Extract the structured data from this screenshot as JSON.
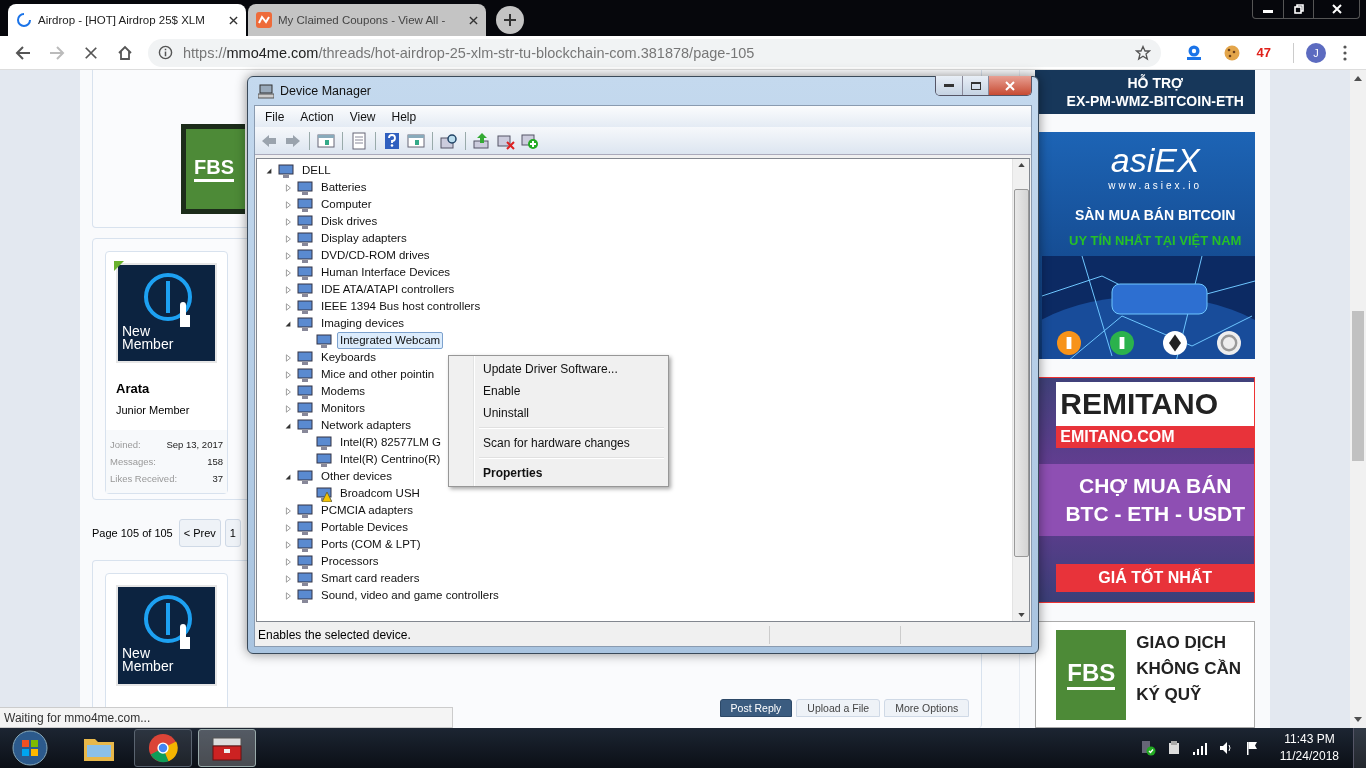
{
  "browser": {
    "tabs": [
      {
        "title": "Airdrop - [HOT] Airdrop 25$ XLM",
        "selected": true,
        "loading": true
      },
      {
        "title": "My Claimed Coupons - View All -",
        "selected": false,
        "loading": false
      }
    ],
    "forward_enabled": false,
    "url_scheme": "https://",
    "url_host": "mmo4me.com",
    "url_path": "/threads/hot-airdrop-25-xlm-str-tu-blockchain-com.381878/page-105",
    "extension_badge": "47",
    "profile_initial": "J",
    "status": "Waiting for mmo4me.com..."
  },
  "forum": {
    "posts": [
      {
        "kind": "banner",
        "banner_text": "FBS"
      },
      {
        "kind": "user",
        "name": "Arata",
        "title": "Junior Member",
        "avatar_label": "New Member",
        "online": true,
        "stats": [
          {
            "label": "Joined:",
            "value": "Sep 13, 2017"
          },
          {
            "label": "Messages:",
            "value": "158"
          },
          {
            "label": "Likes Received:",
            "value": "37"
          }
        ]
      },
      {
        "kind": "user_avatar",
        "avatar_label": "New Member",
        "online": false
      }
    ],
    "pagination": {
      "label": "Page 105 of 105",
      "buttons": [
        "< Prev",
        "1"
      ]
    },
    "actions": [
      {
        "label": "Post Reply",
        "primary": true
      },
      {
        "label": "Upload a File",
        "primary": false
      },
      {
        "label": "More Options",
        "primary": false
      }
    ]
  },
  "ads": [
    {
      "kind": "hotro",
      "lines": [
        "HỖ TRỢ",
        "EX-PM-WMZ-BITCOIN-ETH"
      ]
    },
    {
      "kind": "asiex",
      "logo": "asiEX",
      "site": "www.asiex.io",
      "headline": "SÀN MUA BÁN BITCOIN",
      "tagline": "UY TÍN NHẤT TẠI VIỆT NAM"
    },
    {
      "kind": "remitano",
      "logo": "REMITANO",
      "site": "EMITANO.COM",
      "lines": [
        "CHỢ MUA BÁN",
        "BTC - ETH - USDT"
      ],
      "footer": "GIÁ TỐT NHẤT"
    },
    {
      "kind": "fbs",
      "logo": "FBS",
      "lines": [
        "GIAO DỊCH",
        "KHÔNG CẦN",
        "KÝ QUỸ"
      ]
    }
  ],
  "device_manager": {
    "title": "Device Manager",
    "menu": [
      "File",
      "Action",
      "View",
      "Help"
    ],
    "tree": {
      "label": "DELL",
      "expanded": true,
      "selected": false,
      "children": [
        {
          "label": "Batteries",
          "expanded": false,
          "selected": false
        },
        {
          "label": "Computer",
          "expanded": false,
          "selected": false
        },
        {
          "label": "Disk drives",
          "expanded": false,
          "selected": false
        },
        {
          "label": "Display adapters",
          "expanded": false,
          "selected": false
        },
        {
          "label": "DVD/CD-ROM drives",
          "expanded": false,
          "selected": false
        },
        {
          "label": "Human Interface Devices",
          "expanded": false,
          "selected": false
        },
        {
          "label": "IDE ATA/ATAPI controllers",
          "expanded": false,
          "selected": false
        },
        {
          "label": "IEEE 1394 Bus host controllers",
          "expanded": false,
          "selected": false
        },
        {
          "label": "Imaging devices",
          "expanded": true,
          "selected": false,
          "children": [
            {
              "label": "Integrated Webcam",
              "selected": true,
              "warning": false
            }
          ]
        },
        {
          "label": "Keyboards",
          "expanded": false,
          "selected": false
        },
        {
          "label": "Mice and other pointin",
          "expanded": false,
          "selected": false
        },
        {
          "label": "Modems",
          "expanded": false,
          "selected": false
        },
        {
          "label": "Monitors",
          "expanded": false,
          "selected": false
        },
        {
          "label": "Network adapters",
          "expanded": true,
          "selected": false,
          "children": [
            {
              "label": "Intel(R) 82577LM G",
              "selected": false,
              "warning": false
            },
            {
              "label": "Intel(R) Centrino(R)",
              "selected": false,
              "warning": false
            }
          ]
        },
        {
          "label": "Other devices",
          "expanded": true,
          "selected": false,
          "children": [
            {
              "label": "Broadcom USH",
              "selected": false,
              "warning": true
            }
          ]
        },
        {
          "label": "PCMCIA adapters",
          "expanded": false,
          "selected": false
        },
        {
          "label": "Portable Devices",
          "expanded": false,
          "selected": false
        },
        {
          "label": "Ports (COM & LPT)",
          "expanded": false,
          "selected": false
        },
        {
          "label": "Processors",
          "expanded": false,
          "selected": false
        },
        {
          "label": "Smart card readers",
          "expanded": false,
          "selected": false
        },
        {
          "label": "Sound, video and game controllers",
          "expanded": false,
          "selected": false
        }
      ]
    },
    "status": "Enables the selected device."
  },
  "context_menu": {
    "groups": [
      [
        {
          "label": "Update Driver Software...",
          "default": false
        },
        {
          "label": "Enable",
          "default": false
        },
        {
          "label": "Uninstall",
          "default": false
        }
      ],
      [
        {
          "label": "Scan for hardware changes",
          "default": false
        }
      ],
      [
        {
          "label": "Properties",
          "default": true
        }
      ]
    ]
  },
  "taskbar": {
    "apps": [
      {
        "kind": "explorer",
        "running": false,
        "active": false
      },
      {
        "kind": "chrome",
        "running": true,
        "active": false
      },
      {
        "kind": "toolbox",
        "running": true,
        "active": true
      }
    ],
    "time": "11:43 PM",
    "date": "11/24/2018"
  }
}
